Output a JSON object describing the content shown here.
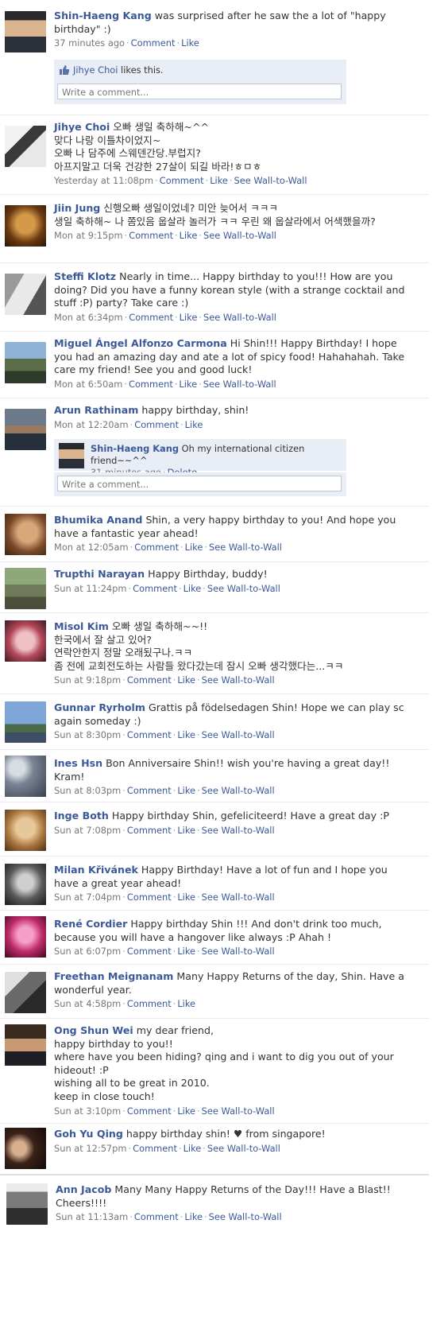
{
  "link_labels": {
    "comment": "Comment",
    "like": "Like",
    "wall": "See Wall-to-Wall",
    "delete": "Delete"
  },
  "write_comment_placeholder": "Write a comment...",
  "posts": [
    {
      "author": "Shin-Haeng Kang",
      "text": "was surprised after he saw the a lot of \"happy birthday\" :)",
      "time": "37 minutes ago",
      "wall": false,
      "likes": {
        "name": "Jihye Choi",
        "suffix": "likes this."
      }
    },
    {
      "author": "Jihye Choi",
      "text": "오빠 생일 축하해~^^\n맞다 나랑 이틀차이었지~\n오빠 나 담주에 스웨덴간당.부럽지?\n아프지말고 더욱 건강한 27살이 되길 바라!ㅎㅁㅎ",
      "time": "Yesterday at 11:08pm",
      "wall": true
    },
    {
      "author": "Jiin Jung",
      "text": "신행오빠 생일이었네? 미안 늦어서 ㅋㅋㅋ\n생일 축하해~ 나 쫌있음 웁살라 놀러가 ㅋㅋ 우린 왜 웁살라에서 어색했을까?",
      "time": "Mon at 9:15pm",
      "wall": true
    },
    {
      "author": "Steffi Klotz",
      "text": "Nearly in time... Happy birthday to you!!! How are you doing? Did you have a funny korean style (with a strange cocktail and stuff :P) party? Take care :)",
      "time": "Mon at 6:34pm",
      "wall": true
    },
    {
      "author": "Miguel Ángel Alfonzo Carmona",
      "text": "Hi Shin!!! Happy Birthday! I hope you had an amazing day and ate a lot of spicy food! Hahahahah. Take care my friend! See you and good luck!",
      "time": "Mon at 6:50am",
      "wall": true
    },
    {
      "author": "Arun Rathinam",
      "text": "happy birthday, shin!",
      "time": "Mon at 12:20am",
      "wall": false,
      "reply": {
        "author": "Shin-Haeng Kang",
        "text": "Oh my international citizen friend~~^^",
        "time": "31 minutes ago"
      }
    },
    {
      "author": "Bhumika Anand",
      "text": "Shin, a very happy birthday to you! And hope you have a fantastic year ahead!",
      "time": "Mon at 12:05am",
      "wall": true
    },
    {
      "author": "Trupthi Narayan",
      "text": "Happy Birthday, buddy!",
      "time": "Sun at 11:24pm",
      "wall": true
    },
    {
      "author": "Misol Kim",
      "text": "오빠 생일 축하해~~!!\n한국에서 잘 살고 있어?\n연락안한지 정말 오래됬구나.ㅋㅋ\n좀 전에 교회전도하는 사람들 왔다갔는데 잠시 오빠 생각했다는...ㅋㅋ",
      "time": "Sun at 9:18pm",
      "wall": true
    },
    {
      "author": "Gunnar Ryrholm",
      "text": "Grattis på födelsedagen Shin! Hope we can play sc again someday :)",
      "time": "Sun at 8:30pm",
      "wall": true
    },
    {
      "author": "Ines Hsn",
      "text": "Bon Anniversaire Shin!! wish you're having a great day!! Kram!",
      "time": "Sun at 8:03pm",
      "wall": true
    },
    {
      "author": "Inge Both",
      "text": "Happy birthday Shin, gefeliciteerd! Have a great day :P",
      "time": "Sun at 7:08pm",
      "wall": true
    },
    {
      "author": "Milan Křivánek",
      "text": "Happy Birthday! Have a lot of fun and I hope you have a great year ahead!",
      "time": "Sun at 7:04pm",
      "wall": true
    },
    {
      "author": "René Cordier",
      "text": "Happy birthday Shin !!! And don't drink too much, because you will have a hangover like always :P Ahah !",
      "time": "Sun at 6:07pm",
      "wall": true
    },
    {
      "author": "Freethan Meignanam",
      "text": "Many Happy Returns of the day, Shin. Have a wonderful year.",
      "time": "Sun at 4:58pm",
      "wall": false
    },
    {
      "author": "Ong Shun Wei",
      "text": "my dear friend,\nhappy birthday to you!!\nwhere have you been hiding? qing and i want to dig you out of your hideout! :P\nwishing all to be great in 2010.\nkeep in close touch!",
      "time": "Sun at 3:10pm",
      "wall": true
    },
    {
      "author": "Goh Yu Qing",
      "text": "happy birthday shin! ♥ from singapore!",
      "time": "Sun at 12:57pm",
      "wall": true
    },
    {
      "author": "Ann Jacob",
      "text": "Many Many Happy Returns of the Day!!! Have a Blast!! Cheers!!!!",
      "time": "Sun at 11:13am",
      "wall": true
    }
  ]
}
